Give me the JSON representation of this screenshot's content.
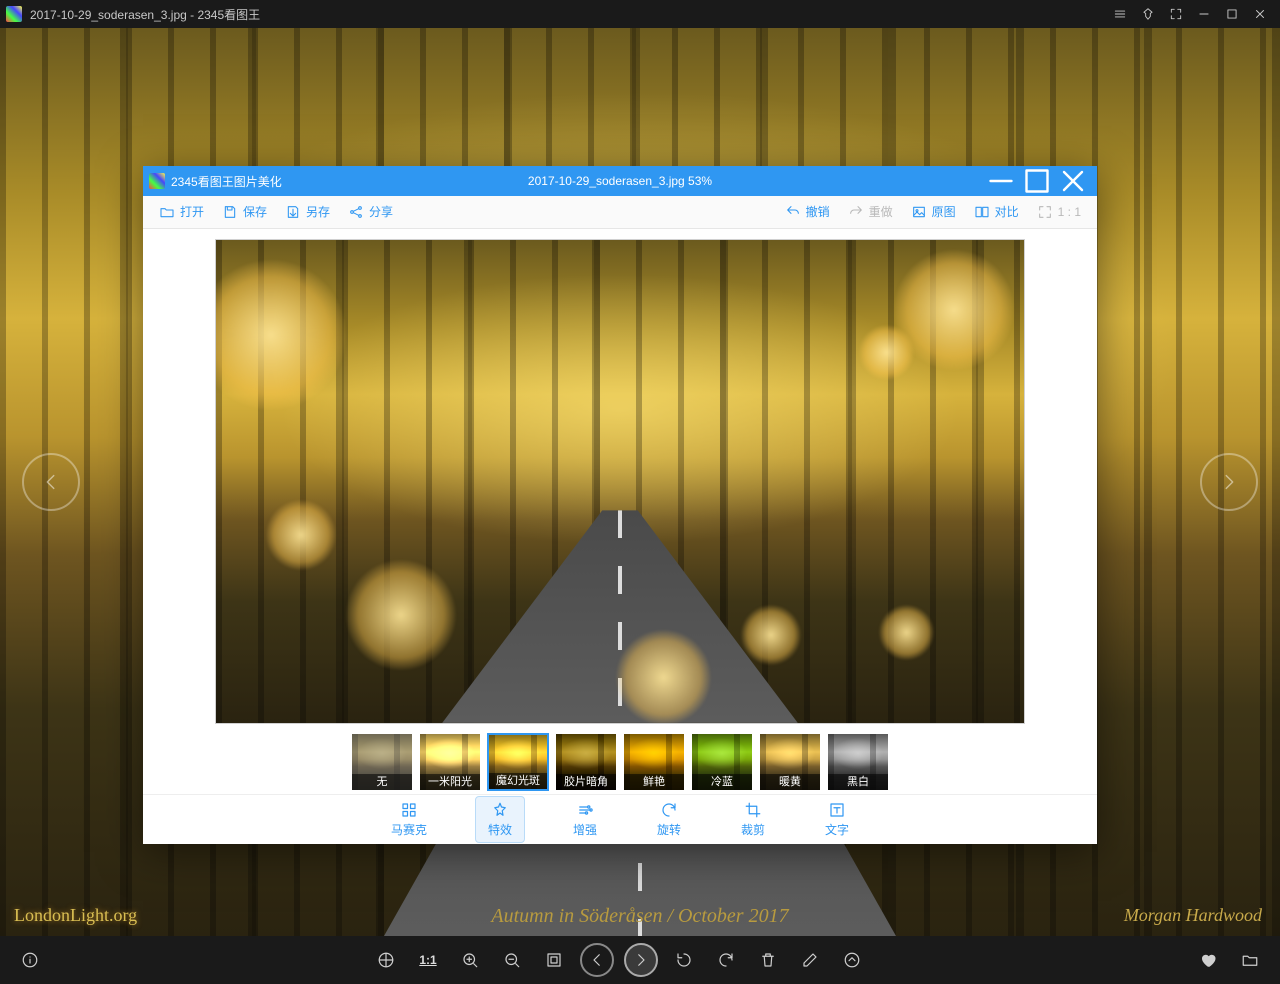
{
  "app": {
    "title": "2017-10-29_soderasen_3.jpg - 2345看图王"
  },
  "captions": {
    "bl": "LondonLight.org",
    "bc": "Autumn in Söderåsen / October 2017",
    "br": "Morgan Hardwood"
  },
  "bottombar": {
    "ratio": "1:1"
  },
  "editor": {
    "title": "2345看图王图片美化",
    "filename": "2017-10-29_soderasen_3.jpg  53%",
    "toolbar": {
      "open": "打开",
      "save": "保存",
      "saveas": "另存",
      "share": "分享",
      "undo": "撤销",
      "redo": "重做",
      "original": "原图",
      "compare": "对比",
      "onetoone": "1 : 1"
    },
    "thumbs": [
      {
        "label": "无",
        "style": "contrast(.6) saturate(.6)"
      },
      {
        "label": "一米阳光",
        "style": "brightness(1.4) sepia(.3)"
      },
      {
        "label": "魔幻光斑",
        "style": "brightness(1.25) saturate(1.15)"
      },
      {
        "label": "胶片暗角",
        "style": "brightness(.8) contrast(1.2)"
      },
      {
        "label": "鲜艳",
        "style": "saturate(1.9)"
      },
      {
        "label": "冷蓝",
        "style": "hue-rotate(30deg) saturate(1.3)"
      },
      {
        "label": "暖黄",
        "style": "sepia(.55) saturate(1.4)"
      },
      {
        "label": "黑白",
        "style": "grayscale(1)"
      }
    ],
    "selected_thumb": 2,
    "tabs": [
      {
        "key": "mosaic",
        "label": "马赛克"
      },
      {
        "key": "effect",
        "label": "特效"
      },
      {
        "key": "enhance",
        "label": "增强"
      },
      {
        "key": "rotate",
        "label": "旋转"
      },
      {
        "key": "crop",
        "label": "裁剪"
      },
      {
        "key": "text",
        "label": "文字"
      }
    ],
    "active_tab": "effect"
  }
}
